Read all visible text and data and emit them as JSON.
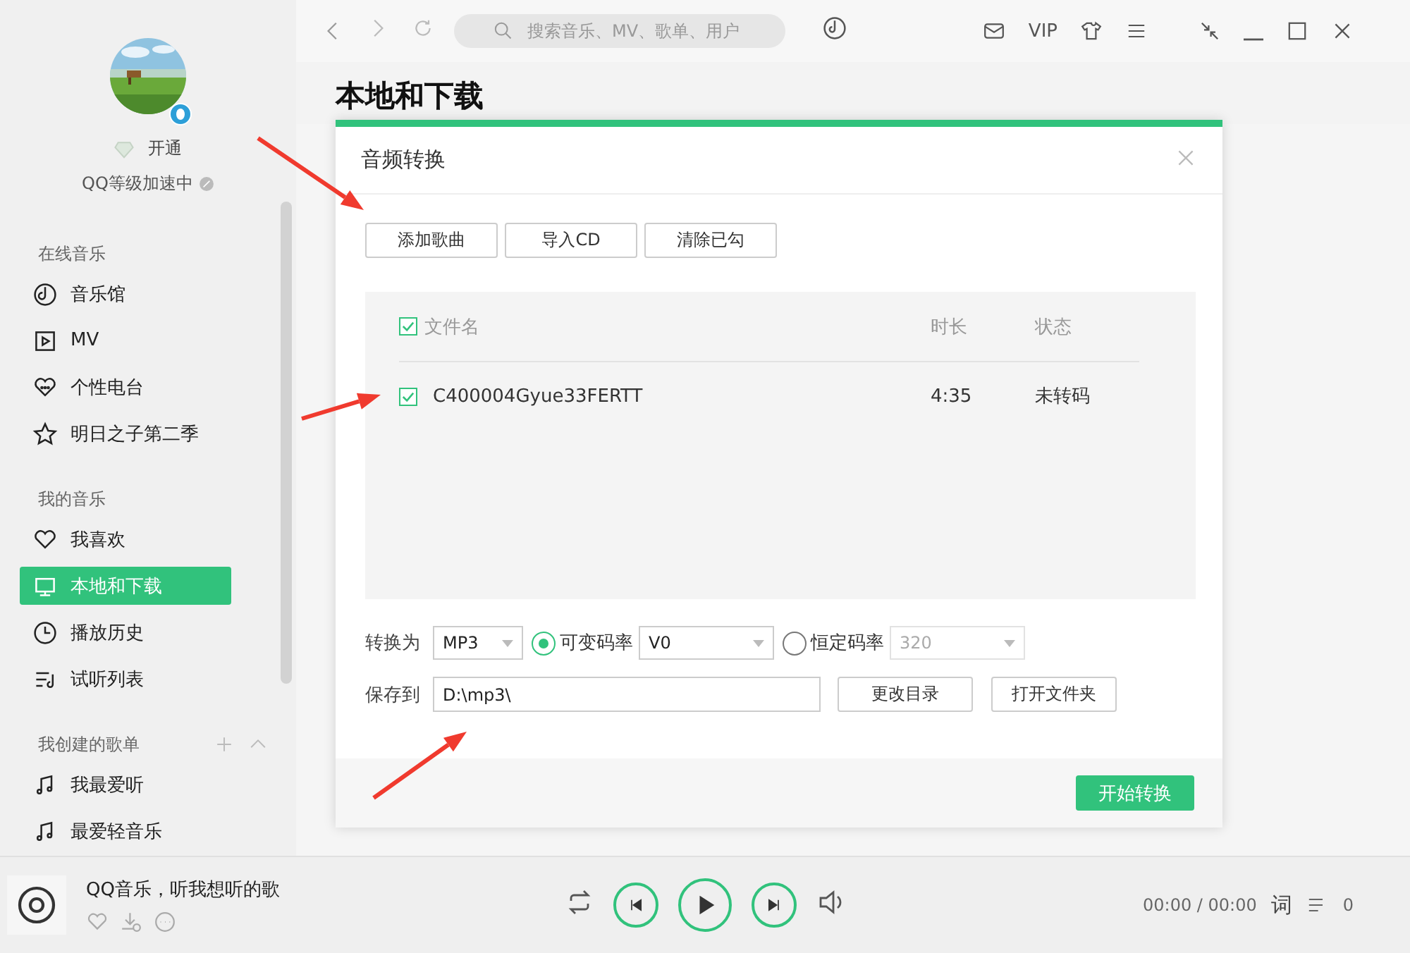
{
  "sidebar": {
    "profile": {
      "vip_label": "开通",
      "level_text": "QQ等级加速中"
    },
    "sections": [
      {
        "title": "在线音乐",
        "items": [
          {
            "label": "音乐馆",
            "selected": false
          },
          {
            "label": "MV",
            "selected": false
          },
          {
            "label": "个性电台",
            "selected": false
          },
          {
            "label": "明日之子第二季",
            "selected": false
          }
        ]
      },
      {
        "title": "我的音乐",
        "items": [
          {
            "label": "我喜欢",
            "selected": false
          },
          {
            "label": "本地和下载",
            "selected": true
          },
          {
            "label": "播放历史",
            "selected": false
          },
          {
            "label": "试听列表",
            "selected": false
          }
        ]
      },
      {
        "title": "我创建的歌单",
        "items": [
          {
            "label": "我最爱听",
            "selected": false
          },
          {
            "label": "最爱轻音乐",
            "selected": false
          }
        ]
      }
    ]
  },
  "topbar": {
    "search": {
      "placeholder": "搜索音乐、MV、歌单、用户"
    },
    "vip": "VIP"
  },
  "page_title": "本地和下载",
  "dialog": {
    "title": "音频转换",
    "buttons": [
      "添加歌曲",
      "导入CD",
      "清除已勾"
    ],
    "table": {
      "header": {
        "checked": true,
        "columns": [
          "文件名",
          "时长",
          "状态"
        ]
      },
      "rows": [
        {
          "checked": true,
          "name": "C400004Gyue33FERTT",
          "duration": "4:35",
          "status": "未转码"
        }
      ]
    },
    "convert_label": "转换为",
    "format": "MP3",
    "modes": [
      {
        "label": "可变码率",
        "value": "V0",
        "selected": true
      },
      {
        "label": "恒定码率",
        "value": "320",
        "selected": false
      }
    ],
    "save_label": "保存到",
    "path": "D:\\mp3\\",
    "path_buttons": [
      "更改目录",
      "打开文件夹"
    ],
    "start_button": "开始转换"
  },
  "player": {
    "song": "QQ音乐，听我想听的歌",
    "time": "00:00 / 00:00",
    "lyrics": "词",
    "playlist_count": "0"
  }
}
